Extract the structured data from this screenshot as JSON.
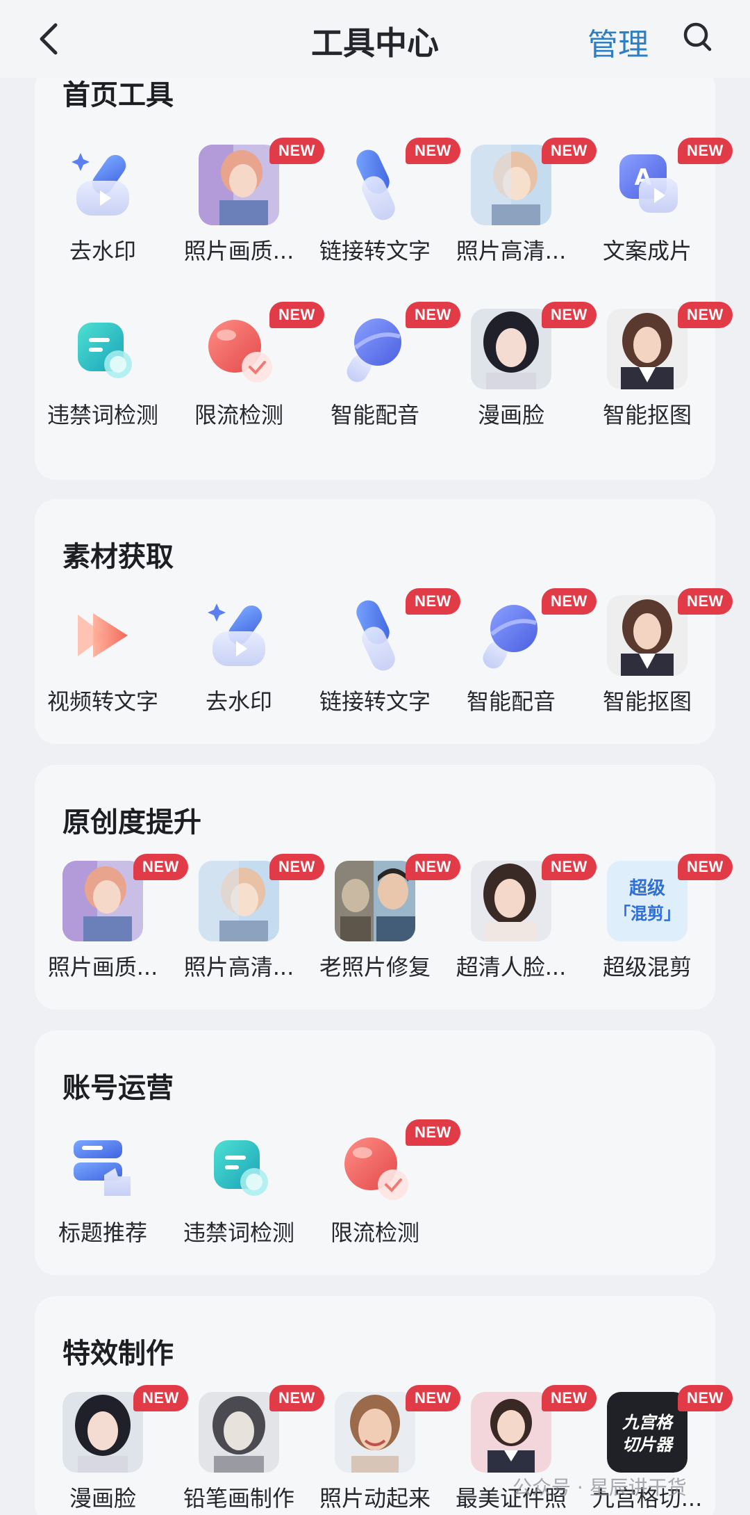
{
  "header": {
    "title": "工具中心",
    "manage_label": "管理"
  },
  "badge_text": "NEW",
  "sections": {
    "home": {
      "title": "首页工具",
      "items": [
        {
          "label": "去水印",
          "icon": "watermark-remove-icon",
          "new": false
        },
        {
          "label": "照片画质...",
          "icon": "photo-quality-thumb",
          "new": true
        },
        {
          "label": "链接转文字",
          "icon": "link-to-text-icon",
          "new": true
        },
        {
          "label": "照片高清...",
          "icon": "photo-hd-thumb",
          "new": true
        },
        {
          "label": "文案成片",
          "icon": "copy-to-video-icon",
          "new": true
        },
        {
          "label": "违禁词检测",
          "icon": "banned-words-icon",
          "new": false
        },
        {
          "label": "限流检测",
          "icon": "throttle-check-icon",
          "new": true
        },
        {
          "label": "智能配音",
          "icon": "smart-dubbing-icon",
          "new": true
        },
        {
          "label": "漫画脸",
          "icon": "comic-face-thumb",
          "new": true
        },
        {
          "label": "智能抠图",
          "icon": "smart-cutout-thumb",
          "new": true
        }
      ]
    },
    "material": {
      "title": "素材获取",
      "items": [
        {
          "label": "视频转文字",
          "icon": "video-to-text-icon",
          "new": false
        },
        {
          "label": "去水印",
          "icon": "watermark-remove-icon",
          "new": false
        },
        {
          "label": "链接转文字",
          "icon": "link-to-text-icon",
          "new": true
        },
        {
          "label": "智能配音",
          "icon": "smart-dubbing-icon",
          "new": true
        },
        {
          "label": "智能抠图",
          "icon": "smart-cutout-thumb",
          "new": true
        }
      ]
    },
    "originality": {
      "title": "原创度提升",
      "items": [
        {
          "label": "照片画质...",
          "icon": "photo-quality-thumb",
          "new": true
        },
        {
          "label": "照片高清...",
          "icon": "photo-hd-thumb",
          "new": true
        },
        {
          "label": "老照片修复",
          "icon": "old-photo-thumb",
          "new": true
        },
        {
          "label": "超清人脸...",
          "icon": "hd-face-thumb",
          "new": true
        },
        {
          "label": "超级混剪",
          "icon": "super-mix-thumb",
          "new": true,
          "thumb_text": [
            "超级",
            "「混剪」"
          ]
        }
      ]
    },
    "account": {
      "title": "账号运营",
      "items": [
        {
          "label": "标题推荐",
          "icon": "title-recommend-icon",
          "new": false
        },
        {
          "label": "违禁词检测",
          "icon": "banned-words-icon",
          "new": false
        },
        {
          "label": "限流检测",
          "icon": "throttle-check-icon",
          "new": true
        }
      ]
    },
    "effects": {
      "title": "特效制作",
      "items": [
        {
          "label": "漫画脸",
          "icon": "comic-face-thumb",
          "new": true
        },
        {
          "label": "铅笔画制作",
          "icon": "pencil-sketch-thumb",
          "new": true
        },
        {
          "label": "照片动起来",
          "icon": "animate-photo-thumb",
          "new": true
        },
        {
          "label": "最美证件照",
          "icon": "id-photo-thumb",
          "new": true
        },
        {
          "label": "九宫格切...",
          "icon": "nine-grid-thumb",
          "new": true,
          "thumb_text": [
            "九宫格",
            "切片器"
          ]
        }
      ]
    }
  },
  "watermark": "公众号 · 星辰讲干货",
  "colors": {
    "accent": "#2f7ec0",
    "badge": "#e23b48",
    "pager_active": "#2a6fb5"
  }
}
